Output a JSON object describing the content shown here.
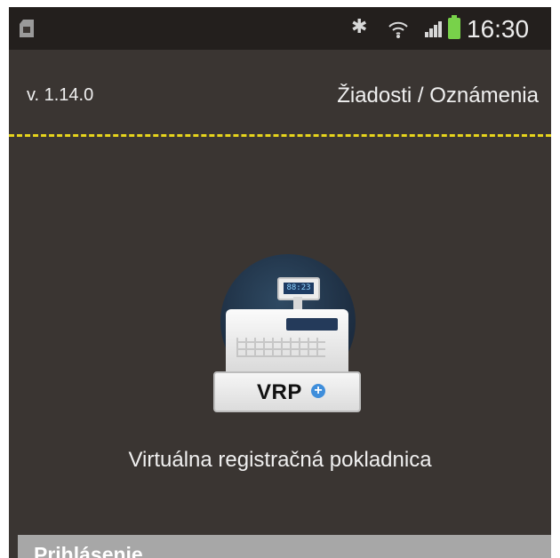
{
  "status_bar": {
    "time": "16:30",
    "icons": [
      "sim-card-icon",
      "bluetooth-icon",
      "wifi-icon",
      "signal-icon",
      "battery-icon"
    ]
  },
  "header": {
    "version": "v. 1.14.0",
    "title": "Žiadosti / Oznámenia"
  },
  "logo": {
    "display_text": "88:23",
    "brand_text": "VRP",
    "plus_symbol": "+"
  },
  "app": {
    "subtitle": "Virtuálna registračná pokladnica"
  },
  "login": {
    "label": "Prihlásenie"
  },
  "colors": {
    "background": "#3a3532",
    "divider": "#e6d41c",
    "battery": "#78d24a",
    "login_bar": "#a7a7a7",
    "accent": "#3f8edb"
  }
}
